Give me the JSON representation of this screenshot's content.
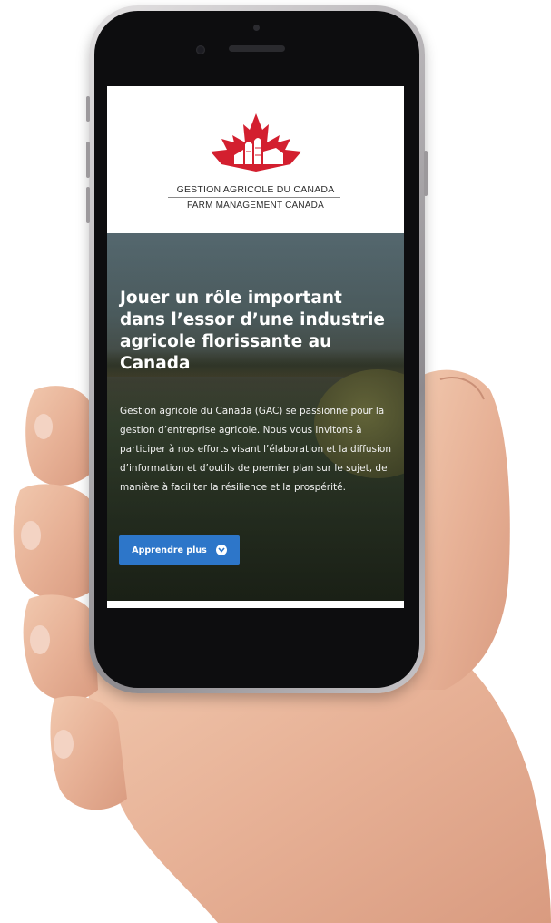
{
  "site": {
    "logo": {
      "icon": "maple-leaf-farm-icon",
      "name_fr": "GESTION AGRICOLE DU CANADA",
      "name_en": "FARM MANAGEMENT CANADA"
    },
    "hero": {
      "title": "Jouer un rôle important dans l’essor d’une industrie agricole florissante au Canada",
      "text": "Gestion agricole du Canada (GAC) se passionne pour la gestion d’entreprise agricole. Nous vous invitons à participer à nos efforts visant l’élaboration et la diffusion d’information et d’outils de premier plan sur le sujet, de manière à faciliter la résilience et la prospérité.",
      "cta_label": "Apprendre plus",
      "cta_icon": "chevron-down-circle-icon"
    }
  },
  "colors": {
    "brand_red": "#d31f2f",
    "button_blue": "#2d76c9"
  }
}
